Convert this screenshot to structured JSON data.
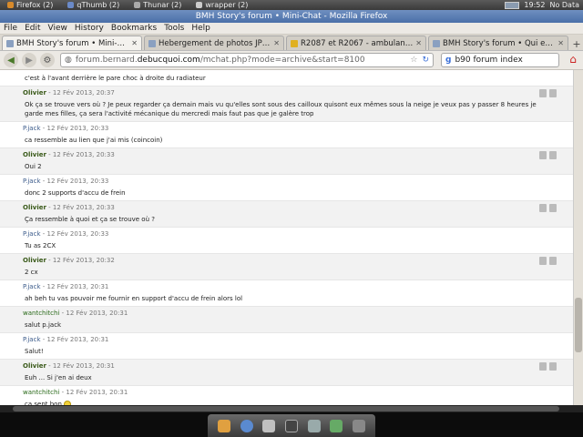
{
  "taskbar": {
    "tasks": [
      {
        "label": "Firefox (2)",
        "icon": "firefox-icon"
      },
      {
        "label": "qThumb (2)",
        "icon": "qthumb-icon"
      },
      {
        "label": "Thunar (2)",
        "icon": "thunar-icon"
      },
      {
        "label": "wrapper (2)",
        "icon": "wrapper-icon"
      }
    ],
    "clock": "19:52",
    "battery": "No Data"
  },
  "window": {
    "title": "BMH Story's forum • Mini-Chat - Mozilla Firefox"
  },
  "menu": [
    "File",
    "Edit",
    "View",
    "History",
    "Bookmarks",
    "Tools",
    "Help"
  ],
  "tabs": [
    {
      "title": "BMH Story's forum • Mini-Chat",
      "active": true
    },
    {
      "title": "Hebergement de photos JPG, J...",
      "active": false
    },
    {
      "title": "R2087 et R2067 - ambulances...",
      "active": false
    },
    {
      "title": "BMH Story's forum • Qui est e...",
      "active": false
    }
  ],
  "nav": {
    "url_prefix": "forum.bernard.",
    "url_domain": "debucquoi.com",
    "url_suffix": "/mchat.php?mode=archive&start=8100",
    "search_text": "b90 forum index"
  },
  "messages": [
    {
      "author": "",
      "date": "",
      "text": "c'est à l'avant derrière le pare choc à droite du radiateur",
      "kind": "",
      "actions": false
    },
    {
      "author": "Olivier",
      "date": "12 Fév 2013, 20:37",
      "text": "Ok ça se trouve vers où ? Je peux regarder ça demain mais vu qu'elles sont sous des cailloux quisont eux mêmes sous la neige je veux pas y passer 8 heures je garde mes filles, ça sera l'activité mécanique du mercredi mais faut pas que je galère trop",
      "kind": "o",
      "actions": true
    },
    {
      "author": "P.jack",
      "date": "12 Fév 2013, 20:33",
      "text": "ca ressemble au lien que j'ai mis (coincoin)",
      "kind": "p",
      "actions": false
    },
    {
      "author": "Olivier",
      "date": "12 Fév 2013, 20:33",
      "text": "Oui 2",
      "kind": "o",
      "actions": true
    },
    {
      "author": "P.jack",
      "date": "12 Fév 2013, 20:33",
      "text": "donc 2 supports d'accu de frein",
      "kind": "p",
      "actions": false
    },
    {
      "author": "Olivier",
      "date": "12 Fév 2013, 20:33",
      "text": "Ça ressemble à quoi et ça se trouve où ?",
      "kind": "o",
      "actions": true
    },
    {
      "author": "P.jack",
      "date": "12 Fév 2013, 20:33",
      "text": "Tu as 2CX",
      "kind": "p",
      "actions": false
    },
    {
      "author": "Olivier",
      "date": "12 Fév 2013, 20:32",
      "text": "2 cx",
      "kind": "o",
      "actions": true
    },
    {
      "author": "P.jack",
      "date": "12 Fév 2013, 20:31",
      "text": "ah beh tu vas pouvoir me fournir en support d'accu de frein alors lol",
      "kind": "p",
      "actions": false
    },
    {
      "author": "wantchitchi",
      "date": "12 Fév 2013, 20:31",
      "text": "salut p.jack",
      "kind": "w",
      "actions": false
    },
    {
      "author": "P.jack",
      "date": "12 Fév 2013, 20:31",
      "text": "Salut!",
      "kind": "p",
      "actions": false
    },
    {
      "author": "Olivier",
      "date": "12 Fév 2013, 20:31",
      "text": "Euh ... Si j'en ai deux",
      "kind": "o",
      "actions": true
    },
    {
      "author": "wantchitchi",
      "date": "12 Fév 2013, 20:31",
      "text": "ca sent bon",
      "kind": "w",
      "actions": false,
      "smiley": true
    }
  ],
  "colors": {
    "author_olivier": "#3a5a1a",
    "author_pjack": "#3a5a8a",
    "author_wantchitchi": "#2a6a1a",
    "titlebar": "#4a6fa8"
  }
}
